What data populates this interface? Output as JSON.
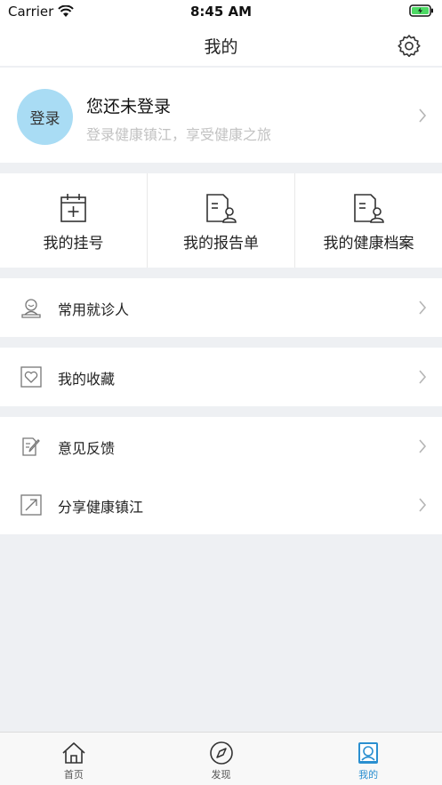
{
  "status_bar": {
    "carrier": "Carrier",
    "time": "8:45 AM"
  },
  "nav": {
    "title": "我的"
  },
  "profile": {
    "avatar_label": "登录",
    "name": "您还未登录",
    "subtitle": "登录健康镇江，享受健康之旅"
  },
  "quick_actions": [
    {
      "label": "我的挂号",
      "icon": "calendar-add-icon"
    },
    {
      "label": "我的报告单",
      "icon": "report-icon"
    },
    {
      "label": "我的健康档案",
      "icon": "health-record-icon"
    }
  ],
  "menu": {
    "patients": "常用就诊人",
    "favorites": "我的收藏",
    "feedback": "意见反馈",
    "share": "分享健康镇江"
  },
  "tabbar": {
    "home": "首页",
    "discover": "发现",
    "mine": "我的"
  },
  "colors": {
    "accent": "#2a8fd0",
    "avatar_bg": "#a9dcf4",
    "page_bg": "#eef0f3"
  }
}
